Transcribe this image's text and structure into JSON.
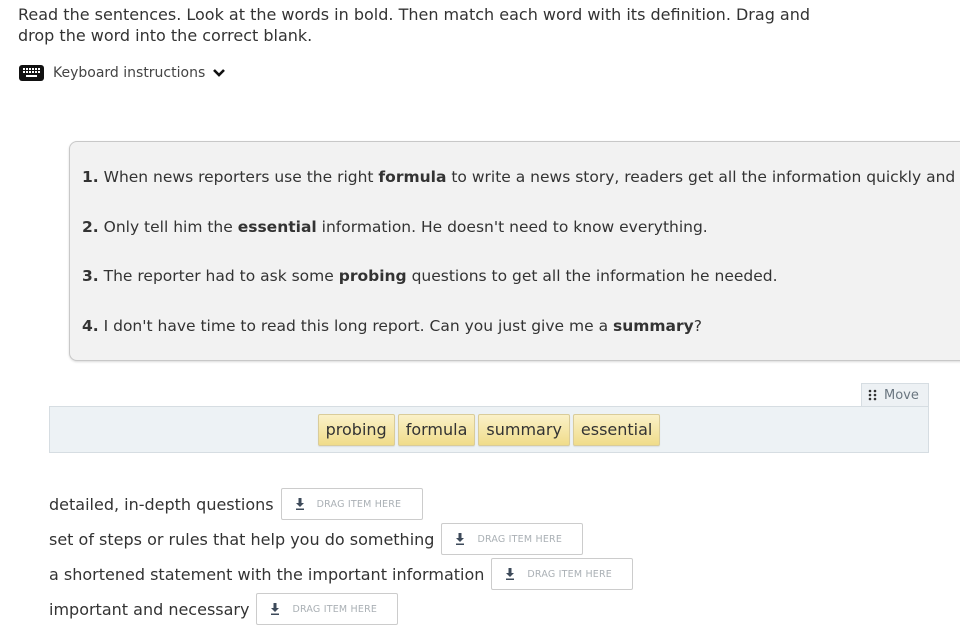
{
  "instructions": "Read the sentences. Look at the words in bold. Then match each word with its definition. Drag and drop the word into the correct blank.",
  "keyboard": {
    "label": "Keyboard instructions",
    "icon": "keyboard-icon",
    "toggle_icon": "chevron-down-icon"
  },
  "sentences": [
    {
      "num": "1.",
      "before": " When news reporters use the right ",
      "bold": "formula",
      "after": " to write a news story, readers get all the information quickly and easily."
    },
    {
      "num": "2.",
      "before": " Only tell him the ",
      "bold": "essential",
      "after": " information. He doesn't need to know everything."
    },
    {
      "num": "3.",
      "before": " The reporter had to ask some ",
      "bold": "probing",
      "after": " questions to get all the information he needed."
    },
    {
      "num": "4.",
      "before": " I don't have time to read this long report. Can you just give me a ",
      "bold": "summary",
      "after": "?"
    }
  ],
  "move": {
    "label": "Move",
    "icon": "drag-handle-icon"
  },
  "word_bank": [
    "probing",
    "formula",
    "summary",
    "essential"
  ],
  "definitions": [
    {
      "text": "detailed, in-depth questions",
      "drop_label": "DRAG ITEM HERE"
    },
    {
      "text": "set of steps or rules that help you do something",
      "drop_label": "DRAG ITEM HERE"
    },
    {
      "text": "a shortened statement with the important information",
      "drop_label": "DRAG ITEM HERE"
    },
    {
      "text": "important and necessary",
      "drop_label": "DRAG ITEM HERE"
    }
  ],
  "colors": {
    "word_tile": "#f0dc8a",
    "word_bank_bg": "#edf2f5",
    "sentence_panel_bg": "#f2f2f2"
  }
}
